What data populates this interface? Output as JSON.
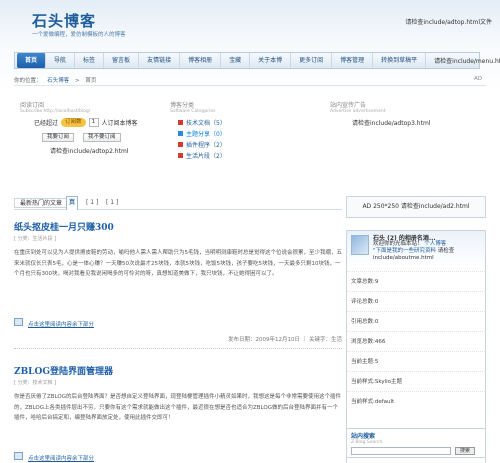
{
  "header": {
    "logo": "石头博客",
    "slogan": "一个爱做编程，爱仿制模板的人的博客",
    "top_include": "请检查include/adtop.html文件"
  },
  "nav": {
    "items": [
      "首页",
      "导航",
      "标签",
      "留言板",
      "友情链接",
      "博客相册",
      "宝藏",
      "关于本博",
      "更多订阅",
      "博客管理",
      "转换到草稿平"
    ],
    "include": "请检查include/menu.html"
  },
  "breadcrumb": {
    "label": "你的位置：",
    "site": "石头博客",
    "sep": ">",
    "current": "首页",
    "right": "AD"
  },
  "subscribe": {
    "title": "阅读订阅",
    "sub": "Subscribe http://localhost/blog/",
    "already_label": "已经超过",
    "badge": "订阅数",
    "count": "1",
    "people_label": "人订阅本博客",
    "btn1": "我要订阅",
    "btn2": "我不要订阅",
    "include": "请检查include/adtop2.html"
  },
  "categories": {
    "title": "博客分类",
    "sub": "Software Categories",
    "items": [
      "技术文档（5）",
      "主题分享（0）",
      "插件程序（2）",
      "生活片段（2）"
    ]
  },
  "ad_right": {
    "title": "站内宣传广告",
    "sub": "Advertise advertisement",
    "include": "请检查include/adtop3.html"
  },
  "tabs": {
    "label": "最新热门的文章",
    "active": "页",
    "p1": "[ 1 ]",
    "p2": "[ 1 ]"
  },
  "posts": [
    {
      "title": "纸头抠皮桂一月只赚300",
      "cat": "[ 分类：生活片段 ]",
      "body": "在重庆到处可以见为人提供擦皮鞋的劳动，喻吗他人需人需人帮助只为5毛钱，当明明测康鞋时总是觉得这个位说会很累，至少我绷，五来米就仅长只表5毛，心是一体心赚？一天赚50次说最才25块钱，本就5块钱，吃饭5块钱，孩子要吃5块钱，一天最多只剩10块钱，一个月也只有300块，喝对我看见我说闲喝多的可怜对的呀，真想知道美做下，我只块钱，不让她得困可以了。",
      "more": "点击这里阅读内容余下部分",
      "meta": "发布日期：2009年12月10日 ｜ 关键字：生活"
    },
    {
      "title": "ZBLOG登陆界面管理器",
      "cat": "[ 分类：技术文档 ]",
      "body": "你是否厌倦了ZBLOG的后台登陆界面？是否想自定义登陆界面，现登陆梗管理插件小精灵如果时，我想这是每个非常需要使用这个插件的，ZBLOG上各类插件层出不穷，只要你有这个需求就能做出这个插件，最近很在想是否也适合为ZBLOG做的后台登陆界面并有一个插件，哈哈后台搞定和，编登陆界面放定处，使用此插件交即可！",
      "more": "点击这里阅读内容余下部分"
    }
  ],
  "sidebar": {
    "ad": "AD 250*250 请检查include/ad2.html",
    "profile_name": "石头 (2) 的相册名酒...",
    "profile_desc1": "欢迎你的光临本站！",
    "profile_desc2_blue": "个人博客",
    "profile_desc3": "\"下面是我的一些研究资料",
    "profile_include": "请检查include/aboutme.html",
    "stats": [
      "文章总数:9",
      "评论总数:0",
      "引用总数:0",
      "浏览总数:466",
      "当前主题:5",
      "当前样式:Skylio主题",
      "当前样式:default"
    ],
    "search_title": "站内搜索",
    "search_sub": "Z-Blog Search",
    "search_btn": "搜索"
  }
}
